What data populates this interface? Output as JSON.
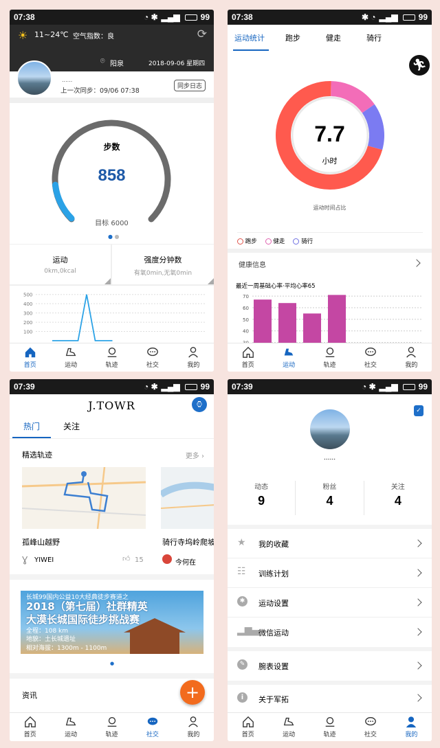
{
  "status_bar": {
    "time1": "07:38",
    "time2": "07:38",
    "time3": "07:39",
    "time4": "07:39",
    "battery": "99"
  },
  "home": {
    "weather_temp": "11~24℃",
    "air_quality": "空气指数：良",
    "location": "阳泉",
    "date": "2018-09-06 星期四",
    "username": "......",
    "last_sync": "上一次同步：09/06 07:38",
    "sync_log_button": "同步日志",
    "gauge_title": "步数",
    "gauge_value": "858",
    "gauge_goal": "目标 6000",
    "gauge_progress": 0.143,
    "sport_title": "运动",
    "sport_sub": "0km,0kcal",
    "intensity_title": "强度分钟数",
    "intensity_sub": "有氧0min,无氧0min",
    "yticks": [
      "500",
      "400",
      "300",
      "200",
      "100"
    ]
  },
  "stats": {
    "tabs": [
      "运动统计",
      "跑步",
      "健走",
      "骑行"
    ],
    "donut_value": "7.7",
    "donut_unit": "小时",
    "donut_caption": "运动时间占比",
    "legend": [
      "跑步",
      "健走",
      "骑行"
    ],
    "health_title": "健康信息",
    "heart_title": "最近一周基础心率·平均心率65",
    "yticks": [
      "70",
      "60",
      "50",
      "40",
      "30"
    ],
    "colors": {
      "run": "#ff5a4e",
      "walk": "#f36db8",
      "ride": "#7b7bf2"
    }
  },
  "social": {
    "logo": "J.TOWR",
    "tabs": [
      "热门",
      "关注"
    ],
    "section_title": "精选轨迹",
    "more": "更多 ›",
    "card1_title": "孤峰山越野",
    "card1_user": "YIWEI",
    "card1_likes": "15",
    "card2_title": "骑行寺坞岭爬坡",
    "card2_user": "今何在",
    "banner_lines": [
      "长城99国内公益10大经典徒步赛道之",
      "2018（第七届）社群精英",
      "大漠长城国际徒步挑战赛",
      "全程：108 km",
      "地貌：土长城遗址",
      "相对海拔：1300m - 1100m"
    ],
    "news_title": "资讯"
  },
  "profile": {
    "name": "......",
    "stats": [
      {
        "label": "动态",
        "value": "9"
      },
      {
        "label": "粉丝",
        "value": "4"
      },
      {
        "label": "关注",
        "value": "4"
      }
    ],
    "menu": [
      "我的收藏",
      "训练计划",
      "运动设置",
      "微信运动",
      "腕表设置",
      "关于军拓"
    ]
  },
  "nav": [
    "首页",
    "运动",
    "轨迹",
    "社交",
    "我的"
  ],
  "chart_data": [
    {
      "type": "line",
      "title": "",
      "x": [
        "",
        "",
        "",
        "",
        "",
        "",
        "",
        ""
      ],
      "ylim": [
        0,
        550
      ],
      "yticks": [
        500,
        400,
        300,
        200,
        100
      ],
      "values": [
        0,
        0,
        0,
        0,
        500,
        0,
        0,
        0
      ]
    },
    {
      "type": "pie",
      "title": "运动时间占比",
      "categories": [
        "跑步",
        "健走",
        "骑行"
      ],
      "values": [
        71,
        15,
        14
      ]
    },
    {
      "type": "bar",
      "title": "最近一周基础心率·平均心率65",
      "categories": [
        "1",
        "2",
        "3",
        "4"
      ],
      "values": [
        67,
        64,
        55,
        71
      ],
      "ylim": [
        28,
        73
      ],
      "yticks": [
        70,
        60,
        50,
        40,
        30
      ]
    }
  ]
}
